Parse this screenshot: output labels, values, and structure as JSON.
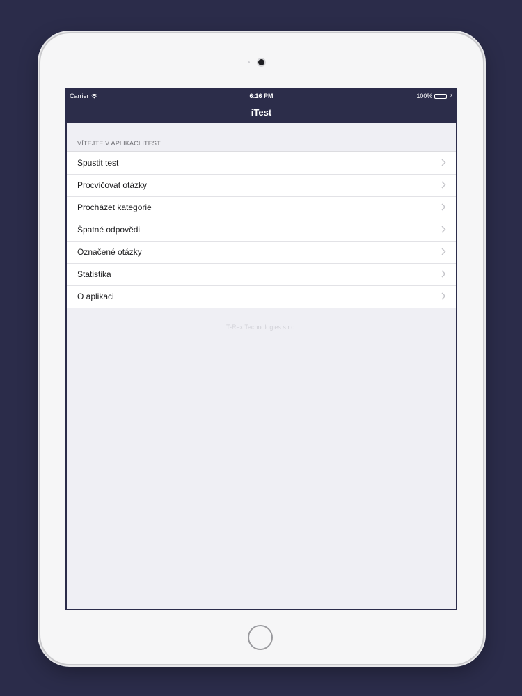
{
  "status_bar": {
    "carrier": "Carrier",
    "wifi_icon": "wifi-icon",
    "time": "6:16 PM",
    "battery": "100%",
    "battery_icon": "battery-icon",
    "charging_icon": "bolt-icon"
  },
  "nav": {
    "title": "iTest"
  },
  "section": {
    "header": "VÍTEJTE V APLIKACI ITEST"
  },
  "menu": {
    "items": [
      {
        "label": "Spustit test"
      },
      {
        "label": "Procvičovat otázky"
      },
      {
        "label": "Procházet kategorie"
      },
      {
        "label": "Špatné odpovědi"
      },
      {
        "label": "Označené otázky"
      },
      {
        "label": "Statistika"
      },
      {
        "label": "O aplikaci"
      }
    ],
    "chevron_icon": "chevron-right-icon"
  },
  "footer": {
    "text": "T-Rex Technologies s.r.o."
  },
  "colors": {
    "background": "#2b2c4a",
    "nav_bar": "#2c2d4a",
    "table_background": "#efeff4",
    "battery_fill": "#4cd964"
  }
}
